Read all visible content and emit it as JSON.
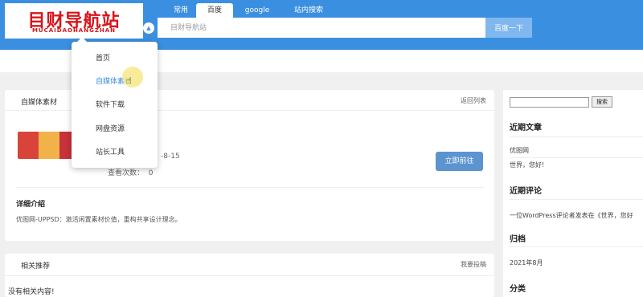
{
  "logo": {
    "main_text": "目财导航站",
    "sub_text": "MUCAIDAOHANGZHAN"
  },
  "search": {
    "tabs": [
      {
        "label": "常用"
      },
      {
        "label": "百度"
      },
      {
        "label": "google"
      },
      {
        "label": "站内搜索"
      }
    ],
    "active_tab": "百度",
    "placeholder": "目财导航站",
    "button_label": "百度一下"
  },
  "dropdown": {
    "items": [
      {
        "label": "首页"
      },
      {
        "label": "自媒体素材"
      },
      {
        "label": "软件下载"
      },
      {
        "label": "网盘资源"
      },
      {
        "label": "站长工具"
      }
    ],
    "hovered_item": "自媒体素材"
  },
  "main": {
    "card_title": "自媒体素材",
    "back_link": "返回列表",
    "date_fragment": "-8-15",
    "views_label": "查看次数：",
    "views_value": "0",
    "go_button": "立即前往",
    "detail_title": "详细介绍",
    "detail_text": "优图网-UPPSD：激活闲置素材价值，重构共享设计理念。"
  },
  "related": {
    "title": "相关推荐",
    "submit_link": "我要投稿",
    "empty_text": "没有相关内容!"
  },
  "sidebar": {
    "search_button": "搜索",
    "recent_posts_title": "近期文章",
    "recent_posts": [
      "优图网",
      "世界，您好!"
    ],
    "recent_comments_title": "近期评论",
    "recent_comment": "一位WordPress评论者发表在《世界，您好",
    "archive_title": "归档",
    "archive_item": "2021年8月",
    "category_title": "分类"
  },
  "colors": {
    "primary": "#3b8fe0",
    "logo_red": "#d9141b",
    "button": "#5b94cf"
  }
}
